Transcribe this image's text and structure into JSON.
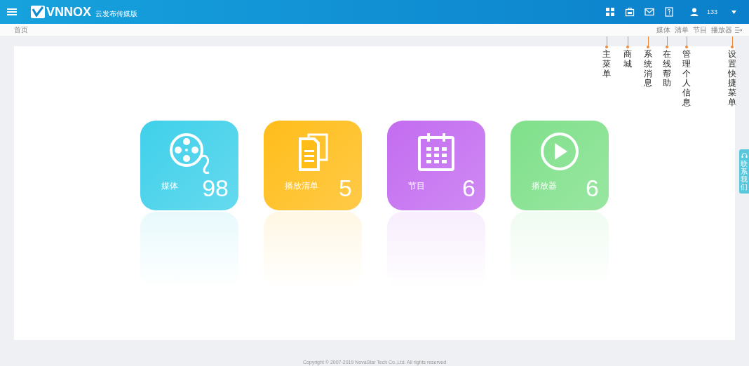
{
  "header": {
    "logo": "VNNOX",
    "edition": "云发布传媒版",
    "user": "133"
  },
  "breadcrumb": "首页",
  "quick_menu": [
    "媒体",
    "清单",
    "节目",
    "播放器"
  ],
  "cards": [
    {
      "kind": "media",
      "label": "媒体",
      "count": "98",
      "color": "#3fd0ea"
    },
    {
      "kind": "playlist",
      "label": "播放清单",
      "count": "5",
      "color": "#ffbd1a"
    },
    {
      "kind": "program",
      "label": "节目",
      "count": "6",
      "color": "#c36cf0"
    },
    {
      "kind": "player",
      "label": "播放器",
      "count": "6",
      "color": "#7fe08a"
    }
  ],
  "side_tab": "联系我们",
  "annotations": [
    "主菜单",
    "商城",
    "系统消息",
    "在线帮助",
    "管理个人信息",
    "设置快捷菜单"
  ],
  "footer": "Copyright © 2007-2019 NovaStar Tech Co.,Ltd. All rights reserved"
}
